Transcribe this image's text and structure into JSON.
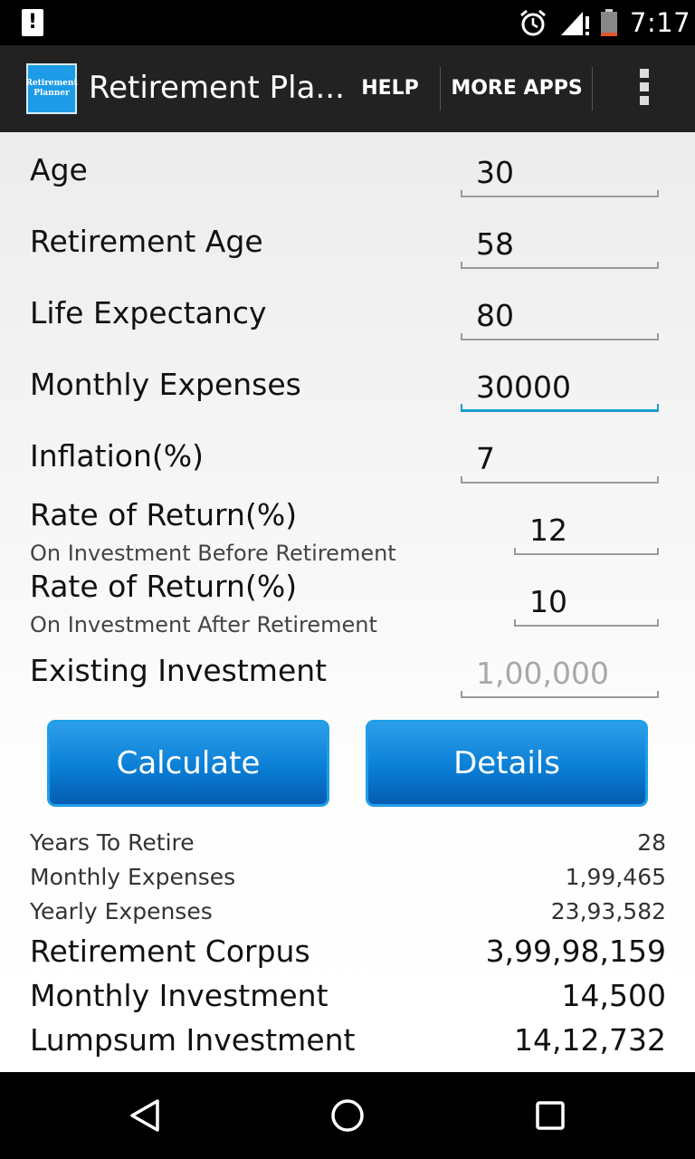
{
  "status_bar": {
    "notification_icon": "alert-icon",
    "alarm_icon": "alarm-clock-icon",
    "signal_icon": "signal-icon",
    "battery_icon": "battery-icon",
    "time": "7:17"
  },
  "action_bar": {
    "app_icon_text_line1": "Retirement",
    "app_icon_text_line2": "Planner",
    "title": "Retirement Pla...",
    "help_label": "HELP",
    "more_apps_label": "MORE APPS",
    "overflow_icon": "overflow-menu-icon"
  },
  "form": {
    "age": {
      "label": "Age",
      "value": "30"
    },
    "retirement_age": {
      "label": "Retirement Age",
      "value": "58"
    },
    "life_expectancy": {
      "label": "Life Expectancy",
      "value": "80"
    },
    "monthly_expenses": {
      "label": "Monthly Expenses",
      "value": "30000"
    },
    "inflation": {
      "label": "Inflation(%)",
      "value": "7"
    },
    "ror_before": {
      "label": "Rate of Return(%)",
      "sublabel": "On Investment Before Retirement",
      "value": "12"
    },
    "ror_after": {
      "label": "Rate of Return(%)",
      "sublabel": "On Investment After Retirement",
      "value": "10"
    },
    "existing_investment": {
      "label": "Existing Investment",
      "placeholder": "1,00,000"
    }
  },
  "buttons": {
    "calculate": "Calculate",
    "details": "Details"
  },
  "results": {
    "years_to_retire": {
      "label": "Years To Retire",
      "value": "28"
    },
    "monthly_expenses": {
      "label": "Monthly Expenses",
      "value": "1,99,465"
    },
    "yearly_expenses": {
      "label": "Yearly Expenses",
      "value": "23,93,582"
    },
    "retirement_corpus": {
      "label": "Retirement Corpus",
      "value": "3,99,98,159"
    },
    "monthly_investment": {
      "label": "Monthly Investment",
      "value": "14,500"
    },
    "lumpsum_investment": {
      "label": "Lumpsum Investment",
      "value": "14,12,732"
    }
  },
  "nav_bar": {
    "back_icon": "back-icon",
    "home_icon": "home-icon",
    "recents_icon": "recents-icon"
  },
  "colors": {
    "accent": "#1c9bd1",
    "button_blue": "#0a7fd6",
    "action_bar": "#222222"
  }
}
